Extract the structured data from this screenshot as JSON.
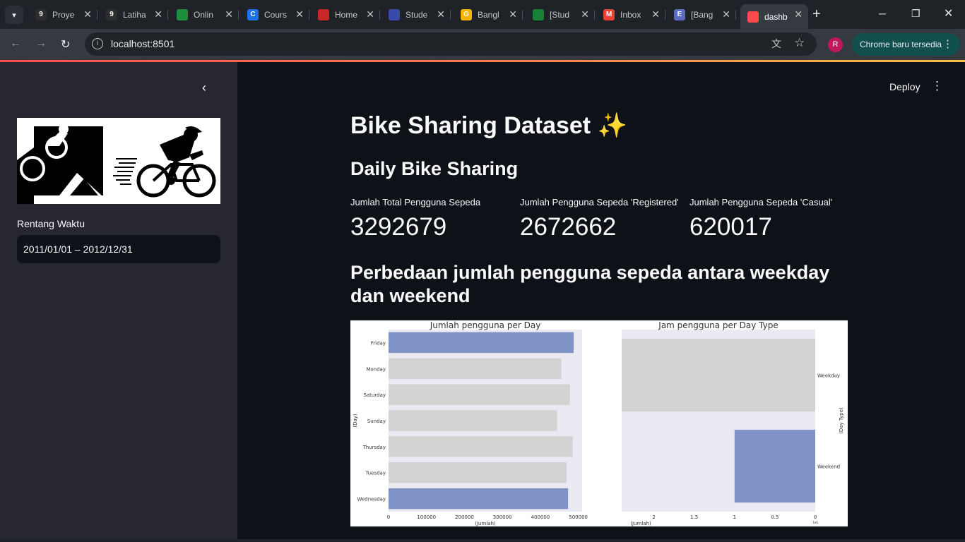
{
  "browser": {
    "tabs": [
      {
        "title": "Proye",
        "icon": "9",
        "color": "#2d2d2d"
      },
      {
        "title": "Latiha",
        "icon": "9",
        "color": "#2d2d2d"
      },
      {
        "title": "Onlin",
        "icon": "classroom",
        "color": "#1e8e3e"
      },
      {
        "title": "Cours",
        "icon": "C",
        "color": "#1a73e8"
      },
      {
        "title": "Home",
        "icon": "dicoding",
        "color": "#c62828"
      },
      {
        "title": "Stude",
        "icon": "stripe",
        "color": "#3949ab"
      },
      {
        "title": "Bangl",
        "icon": "G",
        "color": "#f4b400"
      },
      {
        "title": "[Stud",
        "icon": "sheets",
        "color": "#188038"
      },
      {
        "title": "Inbox",
        "icon": "M",
        "color": "#ea4335"
      },
      {
        "title": "[Bang",
        "icon": "E",
        "color": "#5c6bc0"
      },
      {
        "title": "dashb",
        "icon": "streamlit",
        "color": "#ff4b4b",
        "active": true
      }
    ],
    "url": "localhost:8501",
    "profile_initial": "R",
    "update_label": "Chrome baru tersedia"
  },
  "sidebar": {
    "range_label": "Rentang Waktu",
    "range_value": "2011/01/01 – 2012/12/31"
  },
  "header": {
    "deploy_label": "Deploy"
  },
  "main": {
    "title": "Bike Sharing Dataset ✨",
    "subheader_daily": "Daily Bike Sharing",
    "metrics": [
      {
        "label": "Jumlah Total Pengguna Sepeda",
        "value": "3292679"
      },
      {
        "label": "Jumlah Pengguna Sepeda 'Registered'",
        "value": "2672662"
      },
      {
        "label": "Jumlah Pengguna Sepeda 'Casual'",
        "value": "620017"
      }
    ],
    "subheader_compare": "Perbedaan jumlah pengguna sepeda antara weekday dan weekend"
  },
  "chart_data": [
    {
      "type": "bar",
      "orientation": "horizontal",
      "title": "Jumlah pengguna per Day",
      "xlabel": "(Jumlah)",
      "ylabel": "(Day)",
      "categories": [
        "Friday",
        "Monday",
        "Saturday",
        "Sunday",
        "Thursday",
        "Tuesday",
        "Wednesday"
      ],
      "values": [
        487790,
        455503,
        477807,
        444027,
        485395,
        469109,
        473048
      ],
      "highlight": [
        "Friday",
        "Wednesday"
      ],
      "xlim": [
        0,
        510000
      ],
      "xticks": [
        0,
        100000,
        200000,
        300000,
        400000,
        500000
      ],
      "colors": {
        "highlight": "#8093c6",
        "base": "#d3d3d3",
        "background": "#eaeaf2"
      }
    },
    {
      "type": "bar",
      "orientation": "horizontal",
      "title": "Jam pengguna per Day Type",
      "xlabel": "(Jumlah)",
      "ylabel": "(Day Type)",
      "categories": [
        "Weekday",
        "Weekend"
      ],
      "values": [
        2.4,
        1.0
      ],
      "value_scale_label": "1e6",
      "highlight": [
        "Weekend"
      ],
      "xlim": [
        2.4,
        0
      ],
      "xticks": [
        2.0,
        1.5,
        1.0,
        0.5,
        0.0
      ],
      "x_inverted": true,
      "colors": {
        "highlight": "#8093c6",
        "base": "#d3d3d3",
        "background": "#eaeaf2"
      }
    }
  ]
}
